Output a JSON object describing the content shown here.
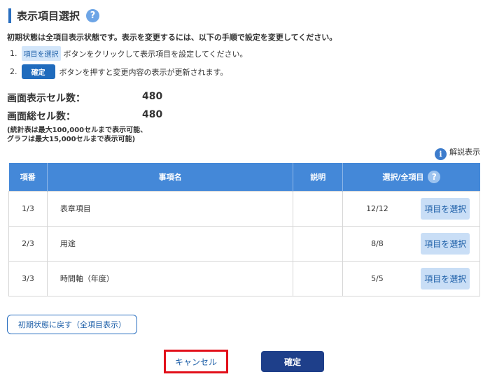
{
  "header": {
    "title": "表示項目選択",
    "help_icon": "?"
  },
  "instructions": {
    "intro": "初期状態は全項目表示状態です。表示を変更するには、以下の手順で設定を変更してください。",
    "step1_num": "1.",
    "step1_chip": "項目を選択",
    "step1_text": "ボタンをクリックして表示項目を設定してください。",
    "step2_num": "2.",
    "step2_chip": "確定",
    "step2_text": "ボタンを押すと変更内容の表示が更新されます。"
  },
  "stats": {
    "display_cells_label": "画面表示セル数：",
    "display_cells_value": "480",
    "total_cells_label": "画面総セル数：",
    "total_cells_value": "480",
    "note_line1": "(統計表は最大100,000セルまで表示可能、",
    "note_line2": "グラフは最大15,000セルまで表示可能)"
  },
  "legend_link": {
    "icon": "i",
    "label": "解説表示"
  },
  "table": {
    "headers": {
      "no": "項番",
      "name": "事項名",
      "desc": "説明",
      "selection": "選択/全項目",
      "selection_help": "?"
    },
    "rows": [
      {
        "no": "1/3",
        "name": "表章項目",
        "desc": "",
        "count": "12/12",
        "button": "項目を選択"
      },
      {
        "no": "2/3",
        "name": "用途",
        "desc": "",
        "count": "8/8",
        "button": "項目を選択"
      },
      {
        "no": "3/3",
        "name": "時間軸（年度）",
        "desc": "",
        "count": "5/5",
        "button": "項目を選択"
      }
    ]
  },
  "actions": {
    "reset": "初期状態に戻す（全項目表示）",
    "cancel": "キャンセル",
    "confirm": "確定"
  },
  "colors": {
    "accent": "#2a6fc0",
    "table_header": "#4488d8",
    "confirm_bg": "#1e3f8a",
    "highlight_border": "#e2101a"
  },
  "icons": {
    "title_help": "question-circle-icon",
    "legend": "info-circle-icon",
    "selection_help": "question-circle-icon"
  }
}
